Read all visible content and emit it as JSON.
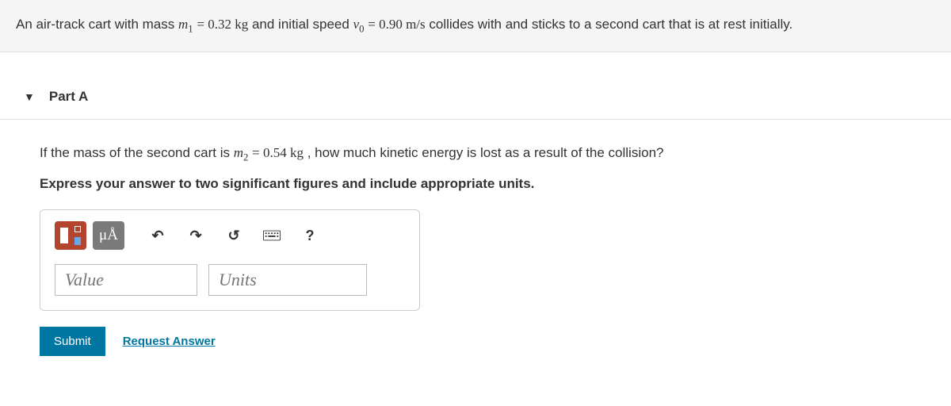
{
  "problem": {
    "pre1": "An air-track cart with mass ",
    "m1_sym": "m",
    "m1_sub": "1",
    "eq": " = ",
    "m1_val": "0.32 kg",
    "mid1": " and initial speed ",
    "v0_sym": "v",
    "v0_sub": "0",
    "v0_val": "0.90 m/s",
    "post": " collides with and sticks to a second cart that is at rest initially."
  },
  "part": {
    "label": "Part A",
    "q_pre": "If the mass of the second cart is ",
    "m2_sym": "m",
    "m2_sub": "2",
    "eq": " = ",
    "m2_val": "0.54 kg",
    "q_post": ", how much kinetic energy is lost as a result of the collision?",
    "instruction": "Express your answer to two significant figures and include appropriate units."
  },
  "toolbar": {
    "units_label": "μÅ",
    "undo": "↶",
    "redo": "↷",
    "reset": "↺",
    "help": "?"
  },
  "inputs": {
    "value_placeholder": "Value",
    "units_placeholder": "Units"
  },
  "actions": {
    "submit": "Submit",
    "request": "Request Answer"
  }
}
